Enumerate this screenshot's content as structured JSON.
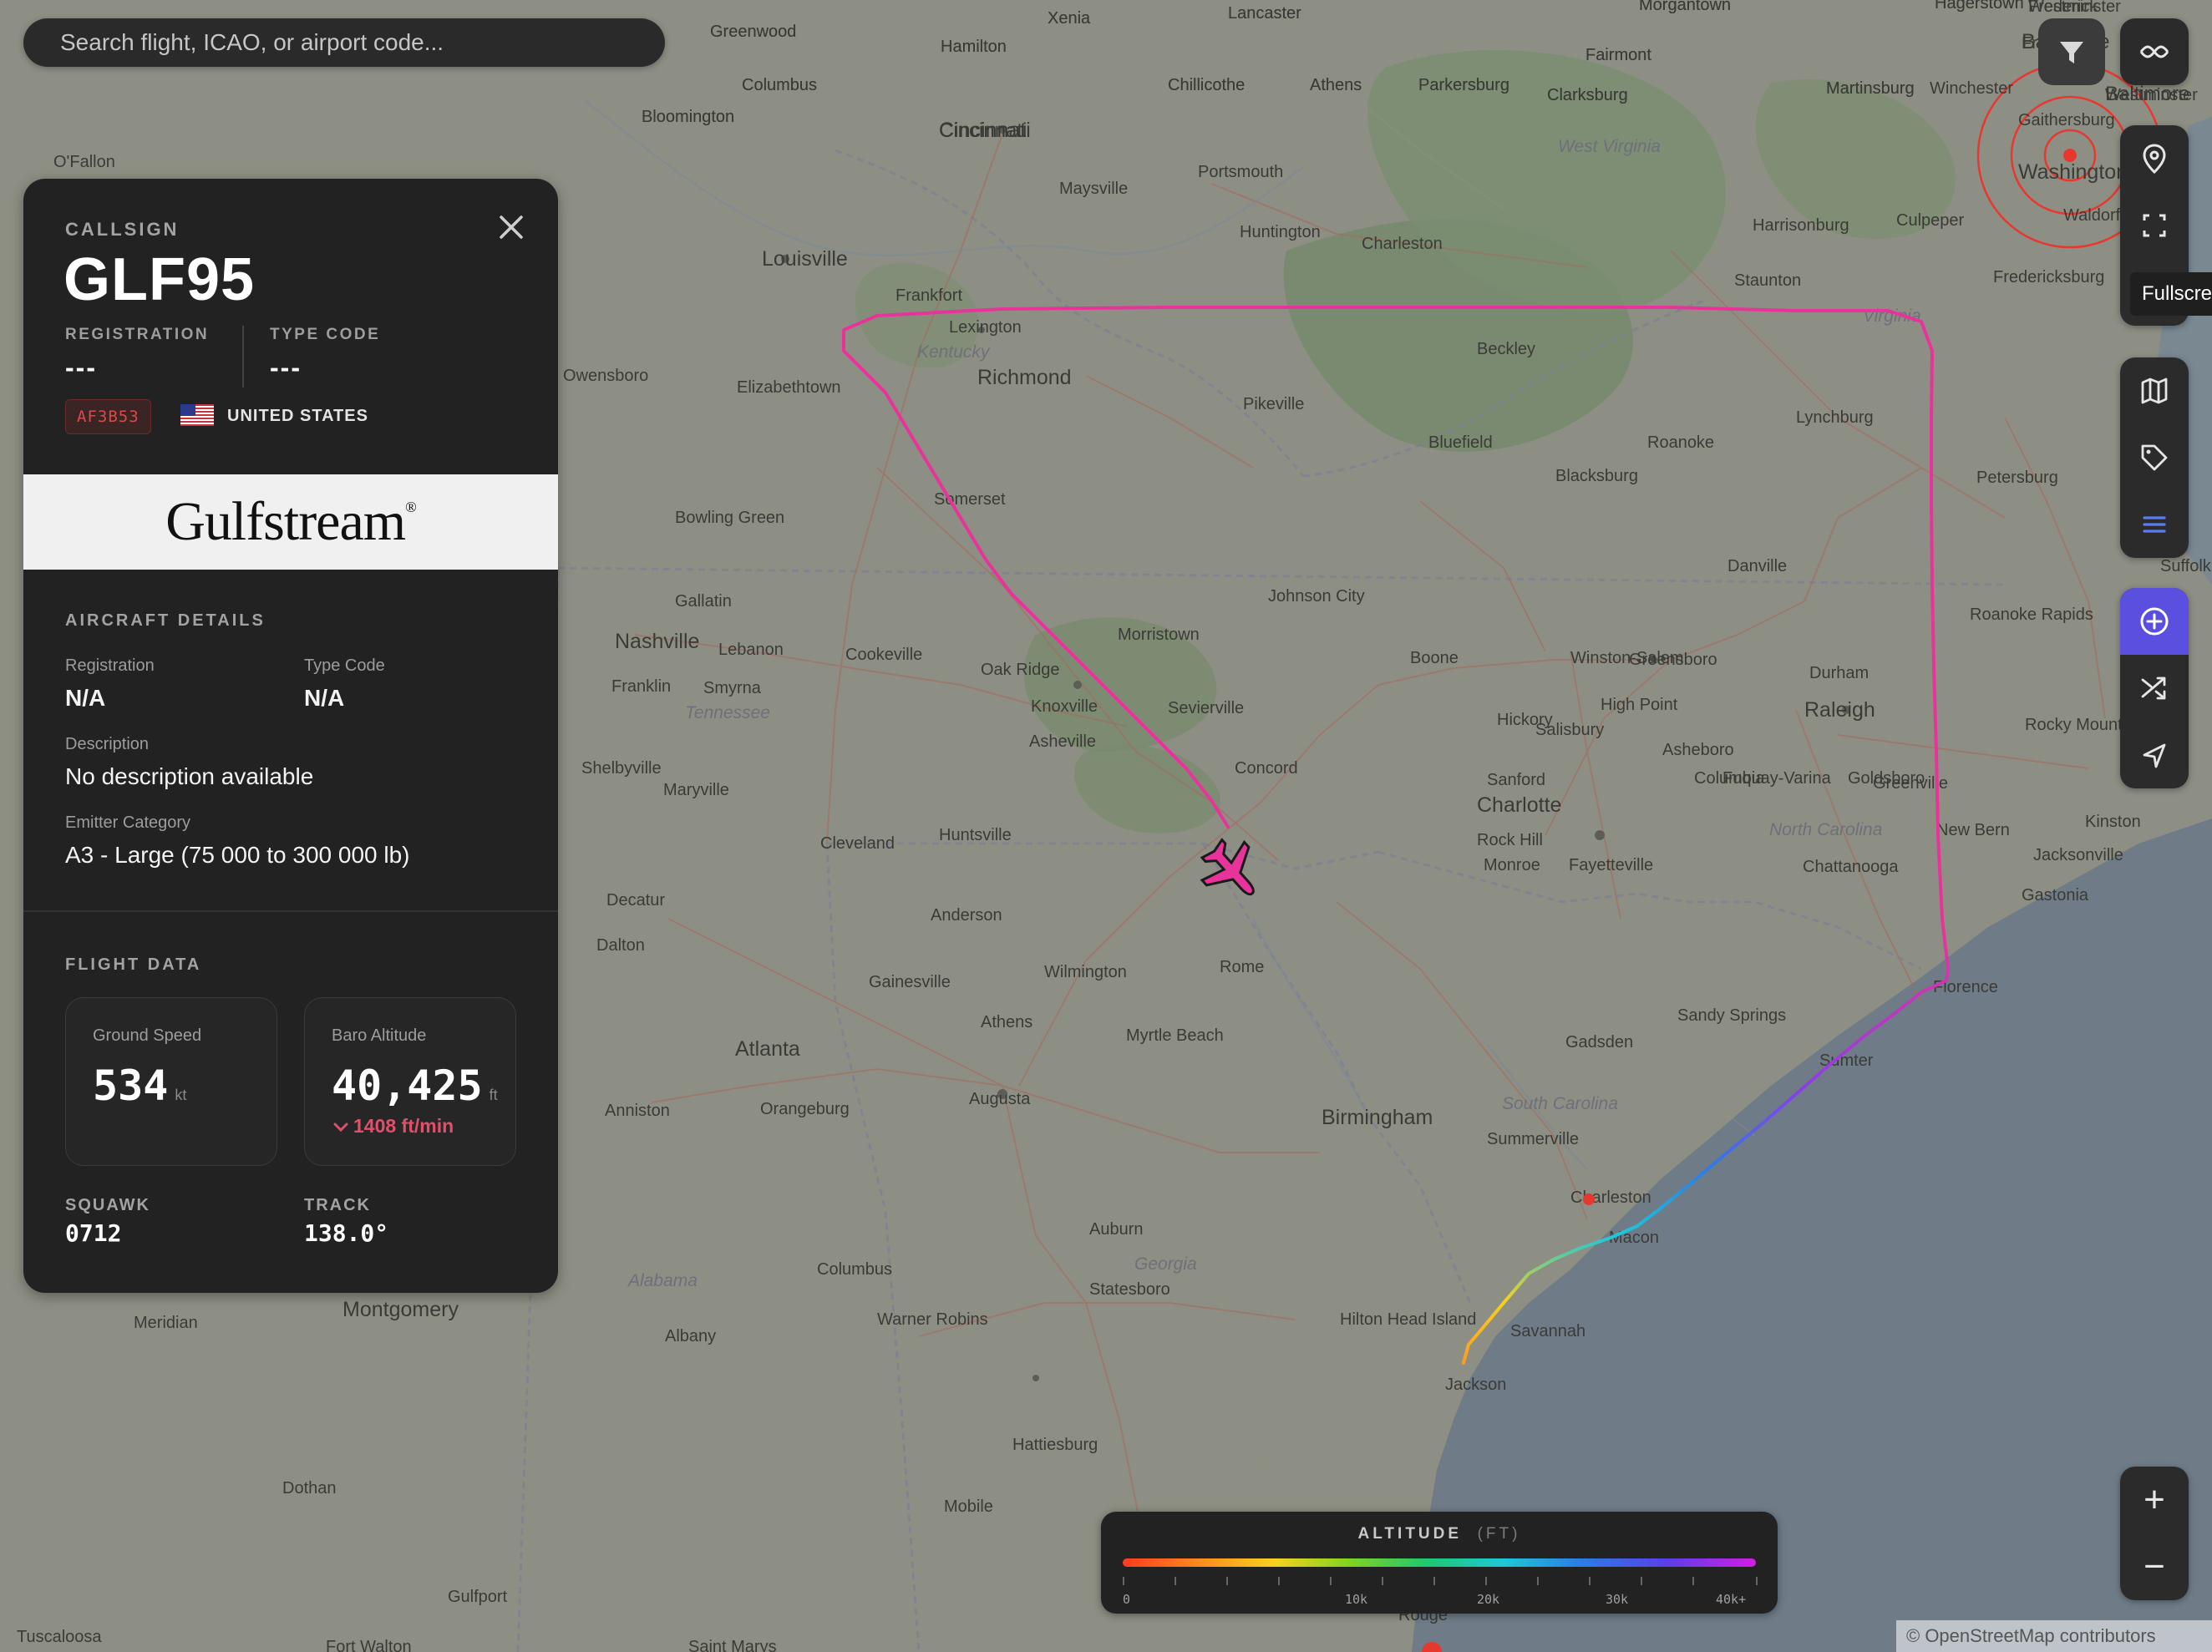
{
  "search": {
    "placeholder": "Search flight, ICAO, or airport code..."
  },
  "panel": {
    "callsign_label": "CALLSIGN",
    "callsign": "GLF95",
    "registration_label": "REGISTRATION",
    "registration_value": "---",
    "type_code_label": "TYPE CODE",
    "type_code_value": "---",
    "hex_code": "AF3B53",
    "country": "UNITED STATES",
    "operator_logo_text": "Gulfstream",
    "aircraft_details": {
      "title": "AIRCRAFT DETAILS",
      "registration_label": "Registration",
      "registration_value": "N/A",
      "type_code_label": "Type Code",
      "type_code_value": "N/A",
      "description_label": "Description",
      "description_value": "No description available",
      "emitter_label": "Emitter Category",
      "emitter_value": "A3 - Large (75 000 to 300 000 lb)"
    },
    "flight_data": {
      "title": "FLIGHT DATA",
      "ground_speed_label": "Ground Speed",
      "ground_speed_value": "534",
      "ground_speed_unit": "kt",
      "baro_altitude_label": "Baro Altitude",
      "baro_altitude_value": "40,425",
      "baro_altitude_unit": "ft",
      "vertical_rate": "1408 ft/min",
      "squawk_label": "SQUAWK",
      "squawk_value": "0712",
      "track_label": "TRACK",
      "track_value": "138.0°"
    }
  },
  "toolbar": {
    "tooltip": "Fullscreen",
    "buttons": [
      "filter-icon",
      "layers-toggle-icon",
      "location-pin-icon",
      "fullscreen-icon",
      "map-icon",
      "tag-icon",
      "list-icon",
      "add-circle-icon",
      "shuffle-icon",
      "navigate-icon"
    ],
    "active_button": "add-circle-icon",
    "accent_color": "#5b4fe0"
  },
  "legend": {
    "title": "ALTITUDE",
    "unit": "(FT)",
    "ticks": [
      "0",
      "10k",
      "20k",
      "30k",
      "40k+"
    ]
  },
  "zoom": {
    "in": "+",
    "out": "−"
  },
  "attribution": "© OpenStreetMap contributors",
  "colors": {
    "track_start": "#ff9b1e",
    "track_end": "#e8339a",
    "aircraft": "#e8339a"
  },
  "map": {
    "cities": [
      "Lancaster",
      "Morgantown",
      "Hagerstown",
      "Frederick",
      "Baltimore",
      "Westminster",
      "Xenia",
      "Greenwood",
      "Hamilton",
      "Columbus",
      "Bloomington",
      "Cincinnati",
      "Chillicothe",
      "Athens",
      "Parkersburg",
      "Fairmont",
      "Clarksburg",
      "Martinsburg",
      "Winchester",
      "Gaithersburg",
      "Washington",
      "Waldorf",
      "O'Fallon",
      "Maysville",
      "Portsmouth",
      "Huntington",
      "Charleston",
      "Harrisonburg",
      "Culpeper",
      "Staunton",
      "Fredericksburg",
      "Louisville",
      "Frankfort",
      "Lexington",
      "Richmond",
      "Elizabethtown",
      "Owensboro",
      "Beckley",
      "Pikeville",
      "Bluefield",
      "Roanoke",
      "Lynchburg",
      "Petersburg",
      "Blacksburg",
      "Somerset",
      "Bowling Green",
      "Danville",
      "Suffolk",
      "Gallatin",
      "Johnson City",
      "Nashville",
      "Lebanon",
      "Cookeville",
      "Morristown",
      "Oak Ridge",
      "Boone",
      "Winston-Salem",
      "Greensboro",
      "Durham",
      "Raleigh",
      "Roanoke Rapids",
      "Rocky Mount",
      "Franklin",
      "Smyrna",
      "Knoxville",
      "Sevierville",
      "High Point",
      "Hickory",
      "Salisbury",
      "Asheboro",
      "Columbia",
      "Shelbyville",
      "Maryville",
      "Asheville",
      "Concord",
      "Sanford",
      "Fuquay-Varina",
      "Goldsboro",
      "Greenville",
      "Kinston",
      "New Bern",
      "Jacksonville",
      "Gastonia",
      "Charlotte",
      "Rock Hill",
      "Monroe",
      "Fayetteville",
      "Chattanooga",
      "Cleveland",
      "Huntsville",
      "Decatur",
      "Dalton",
      "Anderson",
      "Rome",
      "Gainesville",
      "Wilmington",
      "Florence",
      "Sandy Springs",
      "Athens",
      "Myrtle Beach",
      "Sumter",
      "Gadsden",
      "Atlanta",
      "Augusta",
      "Birmingham",
      "Anniston",
      "Orangeburg",
      "Summerville",
      "Charleston",
      "Macon",
      "Auburn",
      "Columbus",
      "Warner Robins",
      "Statesboro",
      "Hilton Head Island",
      "Savannah",
      "Jackson",
      "Meridian",
      "Montgomery",
      "Albany",
      "Hattiesburg",
      "Dothan",
      "Mobile",
      "Gulfport",
      "Fort Walton",
      "Saint Marys",
      "Rouge",
      "Tuscaloosa",
      "Hattiesburg"
    ],
    "states": [
      "West Virginia",
      "Kentucky",
      "Virginia",
      "Tennessee",
      "North Carolina",
      "South Carolina",
      "Georgia",
      "Alabama"
    ]
  }
}
